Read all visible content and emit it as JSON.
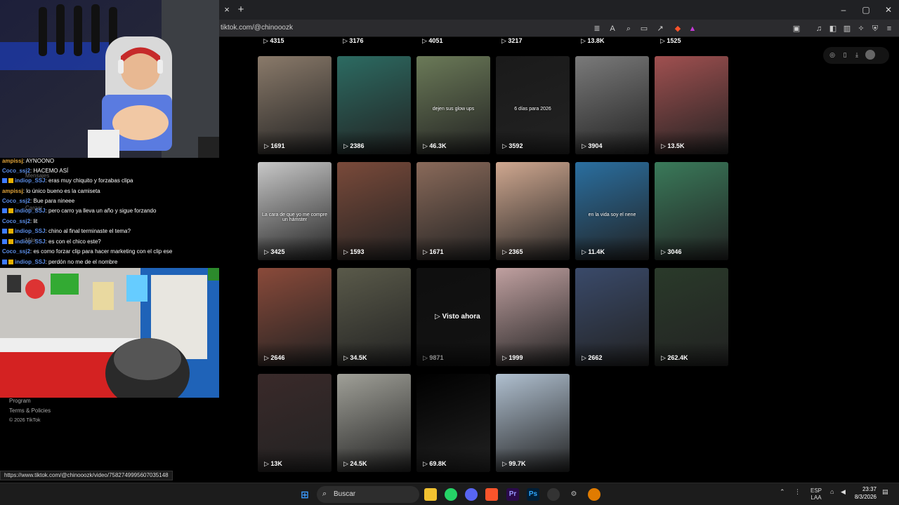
{
  "browser": {
    "url": "tiktok.com/@chinooozk",
    "status_url": "https://www.tiktok.com/@chinooozk/video/7582749995607035148",
    "tab_close": "×",
    "tab_new": "+",
    "min": "–",
    "max": "▢",
    "close": "✕"
  },
  "stream_chat": [
    {
      "user": "ampissj",
      "text": ": AYNOONO",
      "color": "gold"
    },
    {
      "user": "Coco_ssj2",
      "text": ": HACEMO ASÍ",
      "color": "blue"
    },
    {
      "user": "indiop_SSJ",
      "text": ": eras muy chiquito y forzabas clipa",
      "color": "blue",
      "badges": true
    },
    {
      "user": "ampissj",
      "text": ": lo único bueno es la camiseta",
      "color": "gold"
    },
    {
      "user": "Coco_ssj2",
      "text": ": Bue para nineee",
      "color": "blue"
    },
    {
      "user": "indiop_SSJ",
      "text": ": pero carro ya lleva un año y sigue forzando",
      "color": "blue",
      "badges": true
    },
    {
      "user": "Coco_ssj2",
      "text": ": lit",
      "color": "blue"
    },
    {
      "user": "indiop_SSJ",
      "text": ": chino al final terminaste el tema?",
      "color": "blue",
      "badges": true
    },
    {
      "user": "indiop_SSJ",
      "text": ": es con el chico este?",
      "color": "blue",
      "badges": true
    },
    {
      "user": "Coco_ssj2",
      "text": ": es como forzar clip para hacer marketing con el clip ese",
      "color": "blue"
    },
    {
      "user": "indiop_SSJ",
      "text": ": perdón no me de el nombre",
      "color": "blue",
      "badges": true
    }
  ],
  "overlay_labels": {
    "mensajes": "Mensajes",
    "cargar": "Cargar",
    "mas": "Más"
  },
  "footer": {
    "program": "Program",
    "terms": "Terms & Policies",
    "copy": "© 2026 TikTok"
  },
  "top_counts": [
    "4315",
    "3176",
    "4051",
    "3217",
    "13.8K",
    "1525"
  ],
  "videos": [
    {
      "count": "1691",
      "caption": ""
    },
    {
      "count": "2386",
      "caption": ""
    },
    {
      "count": "46.3K",
      "caption": "dejen sus glow ups"
    },
    {
      "count": "3592",
      "caption": "6 días para 2026"
    },
    {
      "count": "3904",
      "caption": ""
    },
    {
      "count": "13.5K",
      "caption": ""
    },
    {
      "count": "3425",
      "caption": "La cara de que yo me compre un hámster"
    },
    {
      "count": "1593",
      "caption": ""
    },
    {
      "count": "1671",
      "caption": ""
    },
    {
      "count": "2365",
      "caption": ""
    },
    {
      "count": "11.4K",
      "caption": "en la vida soy el nene"
    },
    {
      "count": "3046",
      "caption": ""
    },
    {
      "count": "2646",
      "caption": ""
    },
    {
      "count": "34.5K",
      "caption": ""
    },
    {
      "count": "9871",
      "caption": "",
      "watched": "Visto ahora"
    },
    {
      "count": "1999",
      "caption": ""
    },
    {
      "count": "2662",
      "caption": ""
    },
    {
      "count": "262.4K",
      "caption": ""
    },
    {
      "count": "13K",
      "caption": ""
    },
    {
      "count": "24.5K",
      "caption": ""
    },
    {
      "count": "69.8K",
      "caption": ""
    },
    {
      "count": "99.7K",
      "caption": ""
    }
  ],
  "taskbar": {
    "search": "Buscar",
    "lang1": "ESP",
    "lang2": "LAA",
    "time": "23:37",
    "date": "8/3/2026"
  }
}
